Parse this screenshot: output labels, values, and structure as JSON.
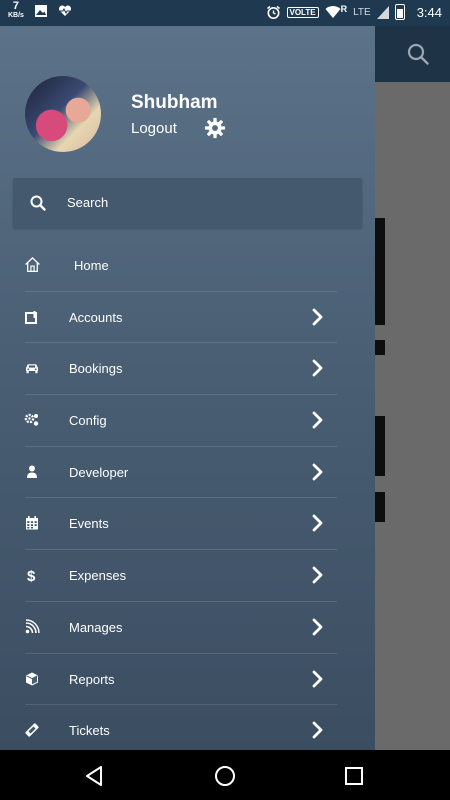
{
  "status_bar": {
    "speed_value": "7",
    "speed_unit": "KB/s",
    "volte": "VOLTE",
    "network": "LTE",
    "roaming": "R",
    "time": "3:44"
  },
  "drawer": {
    "user_name": "Shubham",
    "logout_label": "Logout",
    "search_label": "Search",
    "items": [
      {
        "label": "Home",
        "icon": "home-icon",
        "has_chevron": false
      },
      {
        "label": "Accounts",
        "icon": "accounts-icon",
        "has_chevron": true
      },
      {
        "label": "Bookings",
        "icon": "car-icon",
        "has_chevron": true
      },
      {
        "label": "Config",
        "icon": "gears-icon",
        "has_chevron": true
      },
      {
        "label": "Developer",
        "icon": "person-icon",
        "has_chevron": true
      },
      {
        "label": "Events",
        "icon": "calendar-icon",
        "has_chevron": true
      },
      {
        "label": "Expenses",
        "icon": "dollar-icon",
        "has_chevron": true
      },
      {
        "label": "Manages",
        "icon": "rss-icon",
        "has_chevron": true
      },
      {
        "label": "Reports",
        "icon": "cube-icon",
        "has_chevron": true
      },
      {
        "label": "Tickets",
        "icon": "ticket-icon",
        "has_chevron": true
      }
    ]
  },
  "colors": {
    "drawer_top": "#5c7288",
    "drawer_bottom": "#3b4d61",
    "search_bg": "#45596e",
    "app_bar": "#1e3345"
  }
}
